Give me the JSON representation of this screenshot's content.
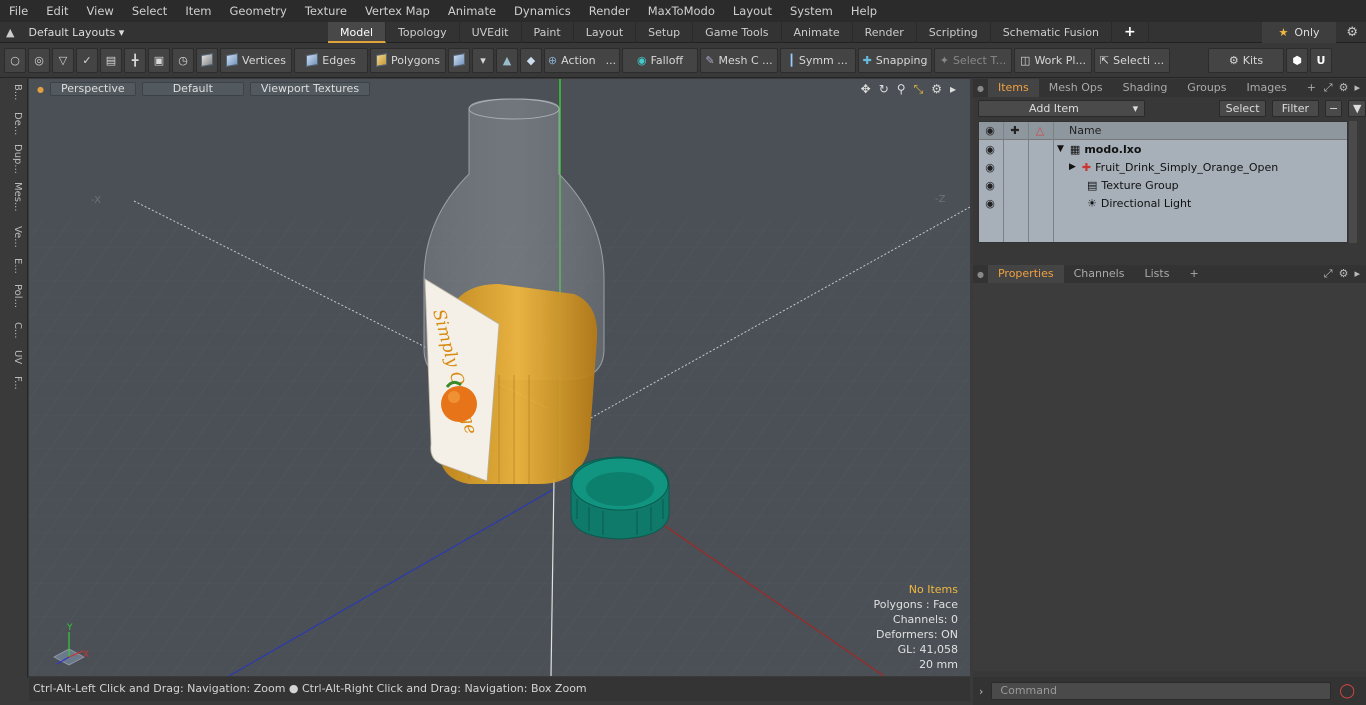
{
  "menubar": {
    "items": [
      "File",
      "Edit",
      "View",
      "Select",
      "Item",
      "Geometry",
      "Texture",
      "Vertex Map",
      "Animate",
      "Dynamics",
      "Render",
      "MaxToModo",
      "Layout",
      "System",
      "Help"
    ]
  },
  "layout_selector": {
    "label": "Default Layouts ▾"
  },
  "tabs": [
    "Model",
    "Topology",
    "UVEdit",
    "Paint",
    "Layout",
    "Setup",
    "Game Tools",
    "Animate",
    "Render",
    "Scripting",
    "Schematic Fusion",
    "+"
  ],
  "active_tab": "Model",
  "only_label": "Only",
  "toolbar": {
    "vertices": "Vertices",
    "edges": "Edges",
    "polygons": "Polygons",
    "action": "Action",
    "falloff": "Falloff",
    "mesh": "Mesh C ...",
    "symm": "Symm ...",
    "snapping": "Snapping",
    "select_t": "Select T...",
    "workplane": "Work Pl...",
    "selecti": "Selecti ...",
    "kits": "Kits"
  },
  "left_tabs": [
    "B...",
    "De...",
    "Dup...",
    "Mes...",
    "Ve...",
    "E...",
    "Pol...",
    "C...",
    "UV",
    "F..."
  ],
  "viewport": {
    "view": "Perspective",
    "style": "Default",
    "textures": "Viewport Textures",
    "axis_x_neg": "-X",
    "axis_z_neg": "-Z",
    "label_text": "Simply Orange",
    "info": {
      "items": "No Items",
      "polygons": "Polygons : Face",
      "channels": "Channels: 0",
      "deformers": "Deformers: ON",
      "gl": "GL: 41,058",
      "scale": "20 mm"
    },
    "gizmo": {
      "y": "Y",
      "x": "X"
    }
  },
  "status": "Ctrl-Alt-Left Click and Drag: Navigation: Zoom ● Ctrl-Alt-Right Click and Drag: Navigation: Box Zoom",
  "right_panel": {
    "tabs": [
      "Items",
      "Mesh Ops",
      "Shading",
      "Groups",
      "Images",
      "+"
    ],
    "add_item": "Add Item",
    "select": "Select",
    "filter": "Filter",
    "name_header": "Name",
    "tree": [
      {
        "label": "modo.lxo"
      },
      {
        "label": "Fruit_Drink_Simply_Orange_Open"
      },
      {
        "label": "Texture Group"
      },
      {
        "label": "Directional Light"
      }
    ],
    "prop_tabs": [
      "Properties",
      "Channels",
      "Lists",
      "+"
    ],
    "command_placeholder": "Command"
  }
}
